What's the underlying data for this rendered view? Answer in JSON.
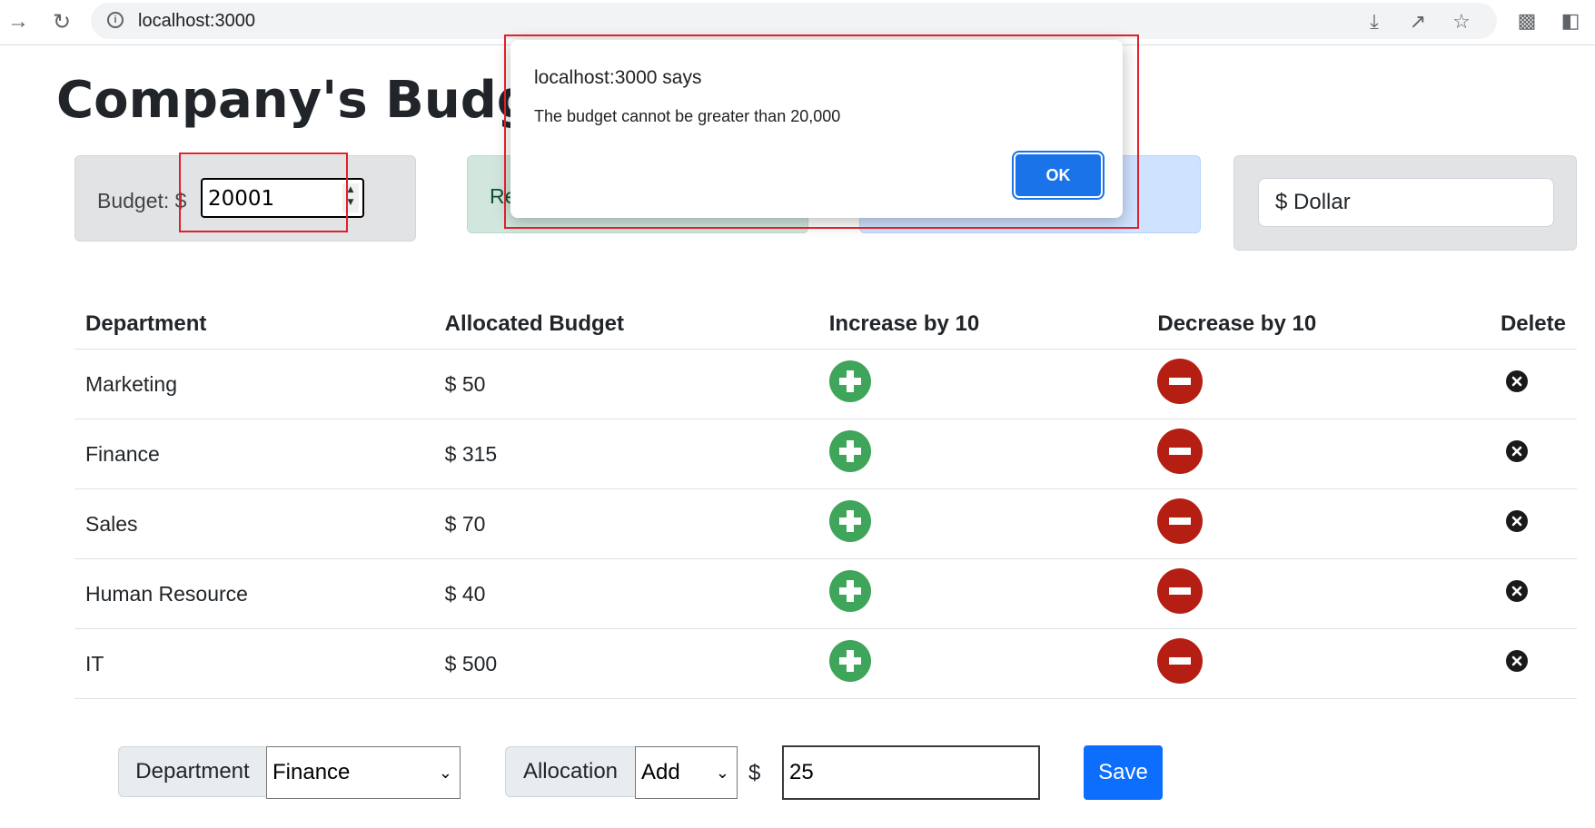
{
  "browser": {
    "url": "localhost:3000"
  },
  "page": {
    "title": "Company's Budget",
    "budget": {
      "label": "Budget: $",
      "value": "20001"
    },
    "remaining_partial": "Re",
    "currency": {
      "selected": "$ Dollar"
    },
    "table": {
      "headers": [
        "Department",
        "Allocated Budget",
        "Increase by 10",
        "Decrease by 10",
        "Delete"
      ],
      "rows": [
        {
          "department": "Marketing",
          "allocated": "$ 50"
        },
        {
          "department": "Finance",
          "allocated": "$ 315"
        },
        {
          "department": "Sales",
          "allocated": "$ 70"
        },
        {
          "department": "Human Resource",
          "allocated": "$ 40"
        },
        {
          "department": "IT",
          "allocated": "$ 500"
        }
      ]
    },
    "form": {
      "department_label": "Department",
      "department_selected": "Finance",
      "allocation_label": "Allocation",
      "allocation_selected": "Add",
      "currency_symbol": "$",
      "amount": "25",
      "save_label": "Save"
    }
  },
  "dialog": {
    "title": "localhost:3000 says",
    "message": "The budget cannot be greater than 20,000",
    "ok_label": "OK"
  },
  "colors": {
    "accent": "#0d6efd",
    "increase_icon": "#3fa55a",
    "decrease_icon": "#b51f13",
    "annotation": "#e0202a"
  }
}
